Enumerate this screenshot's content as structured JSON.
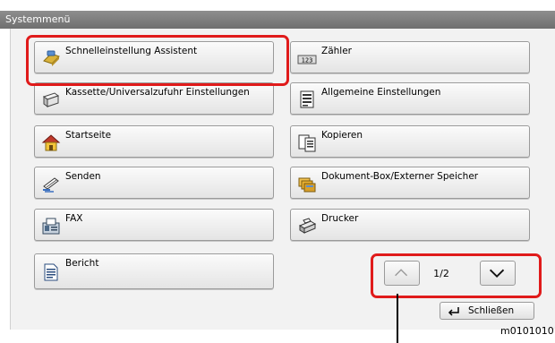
{
  "title": "Systemmenü",
  "menu": [
    {
      "label": "Schnelleinstellung Assistent",
      "icon": "wizard-icon"
    },
    {
      "label": "Zähler",
      "icon": "counter-icon"
    },
    {
      "label": "Kassette/Universalzufuhr Einstellungen",
      "icon": "cassette-icon"
    },
    {
      "label": "Allgemeine Einstellungen",
      "icon": "settings-icon"
    },
    {
      "label": "Startseite",
      "icon": "home-icon"
    },
    {
      "label": "Kopieren",
      "icon": "copy-icon"
    },
    {
      "label": "Senden",
      "icon": "send-icon"
    },
    {
      "label": "Dokument-Box/Externer Speicher",
      "icon": "document-box-icon"
    },
    {
      "label": "FAX",
      "icon": "fax-icon"
    },
    {
      "label": "Drucker",
      "icon": "printer-icon"
    },
    {
      "label": "Bericht",
      "icon": "report-icon"
    }
  ],
  "pagination": {
    "indicator": "1/2"
  },
  "close_label": "Schließen",
  "image_id": "m01010101",
  "colors": {
    "highlight": "#e01b1b",
    "titlebar": "#7a7a7a"
  }
}
